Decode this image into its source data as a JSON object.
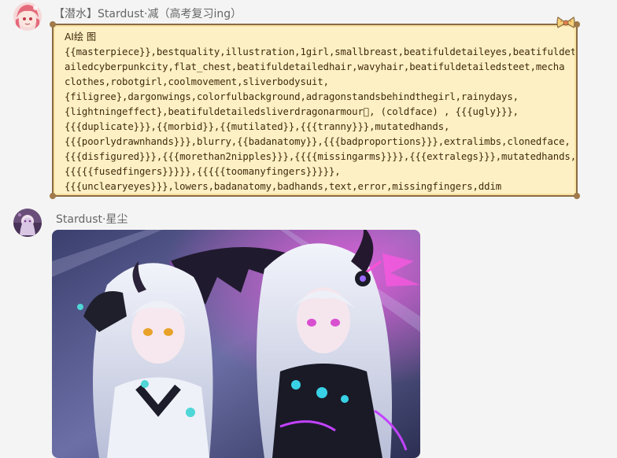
{
  "messages": [
    {
      "sender": "【潜水】Stardust·减（高考复习ing）",
      "lines": [
        "AI绘 图",
        "{{masterpiece}},bestquality,illustration,1girl,smallbreast,beatifuldetaileyes,beatifuldet",
        "ailedcyberpunkcity,flat_chest,beatifuldetailedhair,wavyhair,beatifuldetailedsteet,mecha",
        "clothes,robotgirl,coolmovement,sliverbodysuit,",
        "{filigree},dargonwings,colorfulbackground,adragonstandsbehindthegirl,rainydays,",
        "{lightningeffect},beatifuldetailedsliverdragonarmour\u0000,  (coldface) , {{{ugly}}},",
        "{{{duplicate}}},{{morbid}},{{mutilated}},{{{tranny}}},mutatedhands,",
        "{{{poorlydrawnhands}}},blurry,{{badanatomy}},{{{badproportions}}},extralimbs,clonedface,",
        "{{{disfigured}}},{{{morethan2nipples}}},{{{{missingarms}}}},{{{extralegs}}},mutatedhands,",
        "{{{{{fusedfingers}}}}},{{{{{toomanyfingers}}}}},",
        "{{{unclearyeyes}}},lowers,badanatomy,badhands,text,error,missingfingers,ddim"
      ]
    },
    {
      "sender": "Stardust·星尘",
      "image": "anime-illustration-two-white-haired-girls-with-black-dragon-wings"
    }
  ],
  "colors": {
    "background": "#f4f4f4",
    "bubble_fill": "#fdf0c4",
    "bubble_border": "#8a6a43",
    "bubble_text": "#402a0c",
    "sender_text": "#666666"
  }
}
